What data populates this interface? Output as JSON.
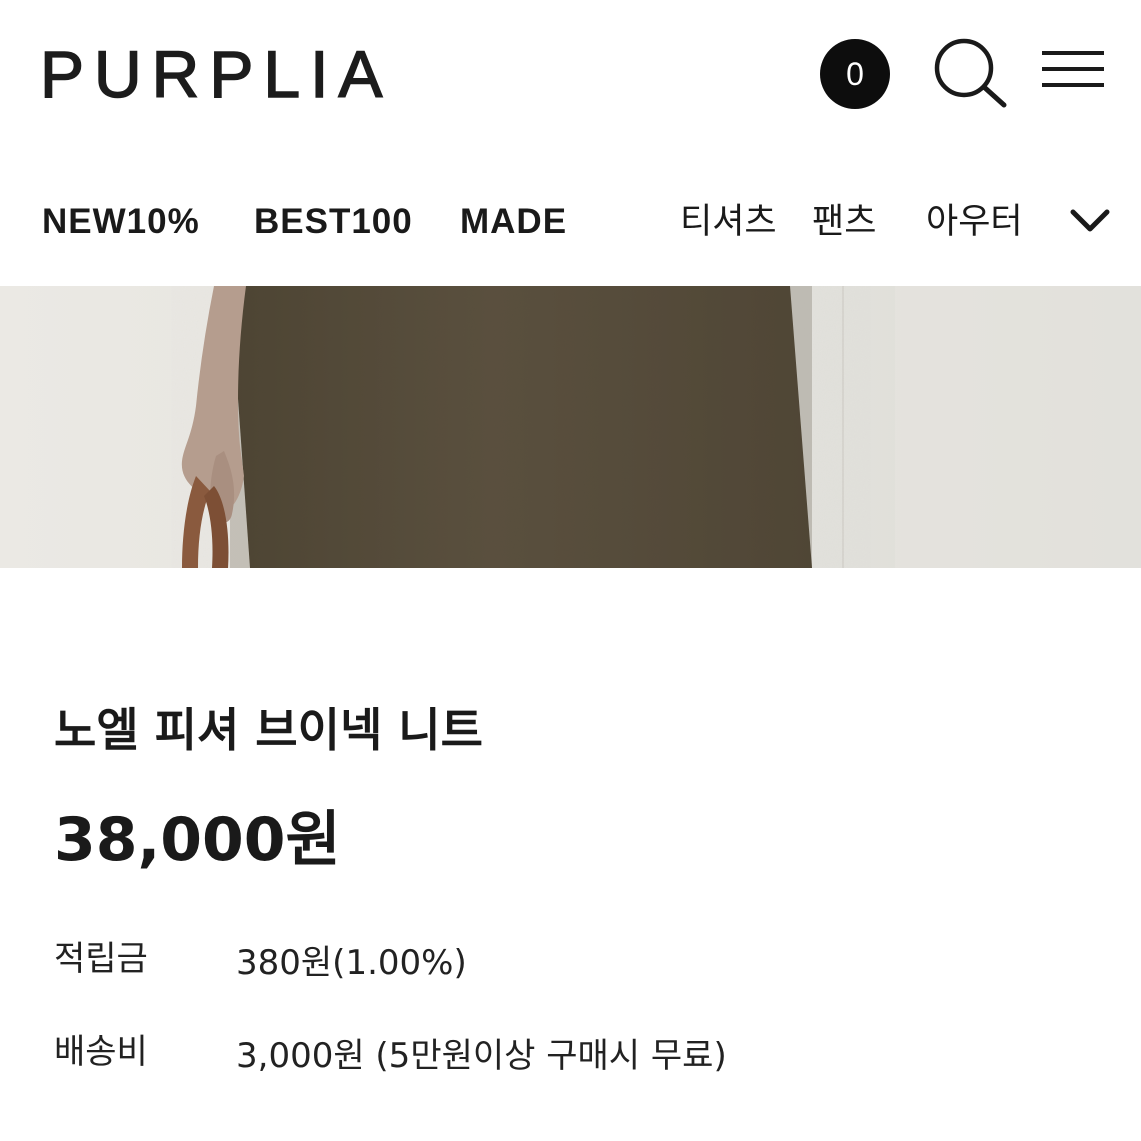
{
  "header": {
    "logo": "PURPLIA",
    "cart_count": "0",
    "icons": {
      "search": "search-icon",
      "menu": "hamburger-menu-icon"
    }
  },
  "nav": {
    "items": [
      "NEW10%",
      "BEST100",
      "MADE",
      "티셔츠",
      "팬츠",
      "아우터"
    ],
    "more_icon": "chevron-down-icon"
  },
  "product": {
    "name": "노엘 피셔 브이넥 니트",
    "price": "38,000원",
    "points_label": "적립금",
    "points_value": "380원(1.00%)",
    "shipping_label": "배송비",
    "shipping_value": "3,000원 (5만원이상 구매시 무료)"
  },
  "colors": {
    "text": "#1a1a1a",
    "badge_bg": "#0d0d0d",
    "knit_brown": "#5a4f3c",
    "wall": "#e4e3de"
  }
}
